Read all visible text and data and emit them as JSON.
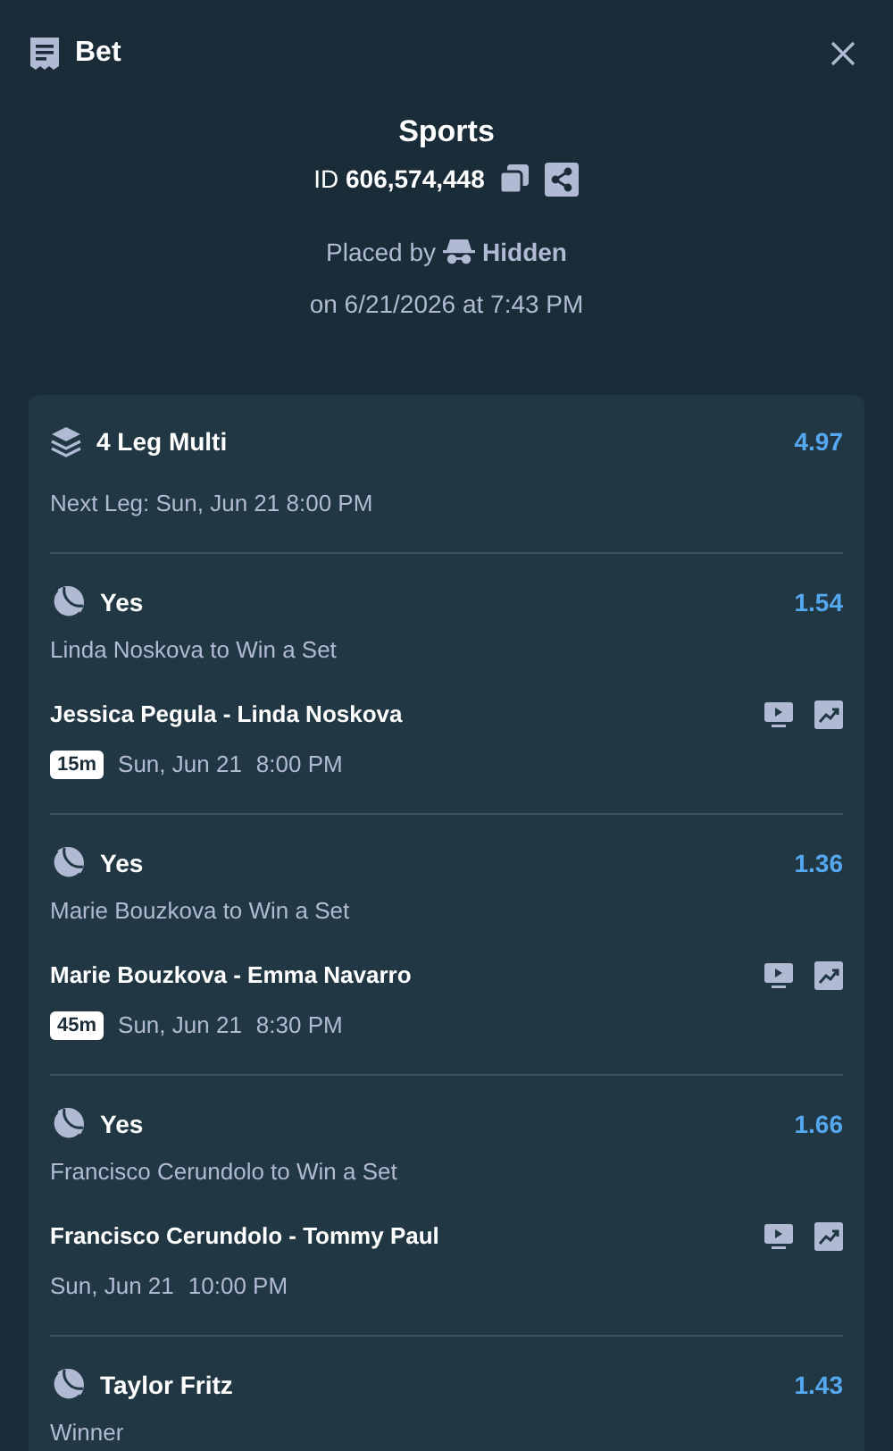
{
  "header": {
    "title": "Bet"
  },
  "summary": {
    "category": "Sports",
    "id_label": "ID",
    "id_value": "606,574,448",
    "placed_by_label": "Placed by",
    "placed_by": "Hidden",
    "placed_on": "on 6/21/2026 at 7:43 PM"
  },
  "multi": {
    "title": "4 Leg Multi",
    "odds": "4.97",
    "next_leg": "Next Leg: Sun, Jun 21 8:00 PM"
  },
  "legs": [
    {
      "pick": "Yes",
      "odds": "1.54",
      "market": "Linda Noskova to Win a Set",
      "match": "Jessica Pegula - Linda Noskova",
      "badge": "15m",
      "date": "Sun, Jun 21",
      "time": "8:00 PM"
    },
    {
      "pick": "Yes",
      "odds": "1.36",
      "market": "Marie Bouzkova to Win a Set",
      "match": "Marie Bouzkova - Emma Navarro",
      "badge": "45m",
      "date": "Sun, Jun 21",
      "time": "8:30 PM"
    },
    {
      "pick": "Yes",
      "odds": "1.66",
      "market": "Francisco Cerundolo to Win a Set",
      "match": "Francisco Cerundolo - Tommy Paul",
      "date": "Sun, Jun 21",
      "time": "10:00 PM"
    },
    {
      "pick": "Taylor Fritz",
      "odds": "1.43",
      "market": "Winner"
    }
  ]
}
